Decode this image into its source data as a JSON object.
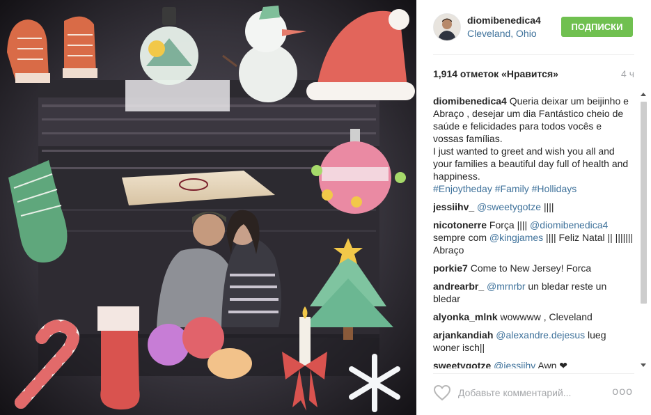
{
  "post": {
    "image_alt": "Festive collage photo of a couple at a basketball arena"
  },
  "header": {
    "username": "diomibenedica4",
    "location": "Cleveland, Ohio",
    "follow_label": "ПОДПИСКИ"
  },
  "stats": {
    "likes": "1,914 отметок «Нравится»",
    "time": "4 ч"
  },
  "comments": [
    {
      "user": "diomibenedica4",
      "parts": [
        {
          "t": "Queria deixar um beijinho e Abraço , desejar um dia Fantástico cheio de saúde e felicidades para todos vocês e vossas famílias.\nI just wanted to greet and wish you all and your families a beautiful day full of health and happiness.\n"
        },
        {
          "m": "#Enjoytheday"
        },
        {
          "t": " "
        },
        {
          "m": "#Family"
        },
        {
          "t": " "
        },
        {
          "m": "#Hollidays"
        }
      ]
    },
    {
      "user": "jessiihv_",
      "parts": [
        {
          "m": "@sweetygotze"
        },
        {
          "t": " ||||"
        }
      ]
    },
    {
      "user": "nicotonerre",
      "parts": [
        {
          "t": "Força |||| "
        },
        {
          "m": "@diomibenedica4"
        },
        {
          "t": " sempre com "
        },
        {
          "m": "@kingjames"
        },
        {
          "t": " |||| Feliz Natal || ||||||| Abraço"
        }
      ]
    },
    {
      "user": "porkie7",
      "parts": [
        {
          "t": "Come to New Jersey! Forca"
        }
      ]
    },
    {
      "user": "andrearbr_",
      "parts": [
        {
          "m": "@mrnrbr"
        },
        {
          "t": " un bledar reste un bledar"
        }
      ]
    },
    {
      "user": "alyonka_mlnk",
      "parts": [
        {
          "t": "wowwww , Cleveland"
        }
      ]
    },
    {
      "user": "arjankandiah",
      "parts": [
        {
          "m": "@alexandre.dejesus"
        },
        {
          "t": " lueg woner isch||"
        }
      ]
    },
    {
      "user": "sweetygotze",
      "parts": [
        {
          "m": "@jessiihv"
        },
        {
          "t": "  Awn ❤"
        }
      ]
    }
  ],
  "add_comment": {
    "placeholder": "Добавьте комментарий...",
    "more_label": "ooo"
  },
  "colors": {
    "follow": "#70c050",
    "link": "#3f729b",
    "muted": "#a5a7aa"
  },
  "icons": [
    "heart-icon",
    "more-options-icon",
    "scroll-up-icon",
    "scroll-down-icon"
  ]
}
